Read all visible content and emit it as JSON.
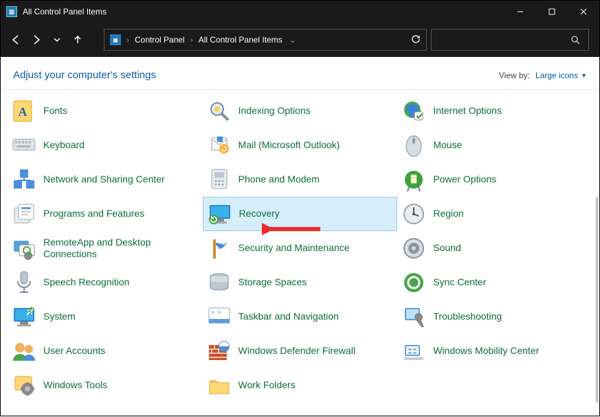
{
  "window": {
    "title": "All Control Panel Items"
  },
  "breadcrumb": {
    "root": "Control Panel",
    "current": "All Control Panel Items"
  },
  "header": {
    "adjust_text": "Adjust your computer's settings",
    "viewby_label": "View by:",
    "viewby_value": "Large icons"
  },
  "items": [
    {
      "label": "Fonts",
      "icon": "fonts-icon"
    },
    {
      "label": "Indexing Options",
      "icon": "indexing-icon"
    },
    {
      "label": "Internet Options",
      "icon": "internet-icon"
    },
    {
      "label": "Keyboard",
      "icon": "keyboard-icon"
    },
    {
      "label": "Mail (Microsoft Outlook)",
      "icon": "mail-icon"
    },
    {
      "label": "Mouse",
      "icon": "mouse-icon"
    },
    {
      "label": "Network and Sharing Center",
      "icon": "network-icon"
    },
    {
      "label": "Phone and Modem",
      "icon": "phone-icon"
    },
    {
      "label": "Power Options",
      "icon": "power-icon"
    },
    {
      "label": "Programs and Features",
      "icon": "programs-icon"
    },
    {
      "label": "Recovery",
      "icon": "recovery-icon",
      "highlight": true
    },
    {
      "label": "Region",
      "icon": "region-icon"
    },
    {
      "label": "RemoteApp and Desktop Connections",
      "icon": "remoteapp-icon"
    },
    {
      "label": "Security and Maintenance",
      "icon": "security-icon"
    },
    {
      "label": "Sound",
      "icon": "sound-icon"
    },
    {
      "label": "Speech Recognition",
      "icon": "speech-icon"
    },
    {
      "label": "Storage Spaces",
      "icon": "storage-icon"
    },
    {
      "label": "Sync Center",
      "icon": "sync-icon"
    },
    {
      "label": "System",
      "icon": "system-icon"
    },
    {
      "label": "Taskbar and Navigation",
      "icon": "taskbar-icon"
    },
    {
      "label": "Troubleshooting",
      "icon": "troubleshoot-icon"
    },
    {
      "label": "User Accounts",
      "icon": "users-icon"
    },
    {
      "label": "Windows Defender Firewall",
      "icon": "firewall-icon"
    },
    {
      "label": "Windows Mobility Center",
      "icon": "mobility-icon"
    },
    {
      "label": "Windows Tools",
      "icon": "tools-icon"
    },
    {
      "label": "Work Folders",
      "icon": "workfolders-icon"
    }
  ],
  "annotation": {
    "target": "Recovery"
  }
}
